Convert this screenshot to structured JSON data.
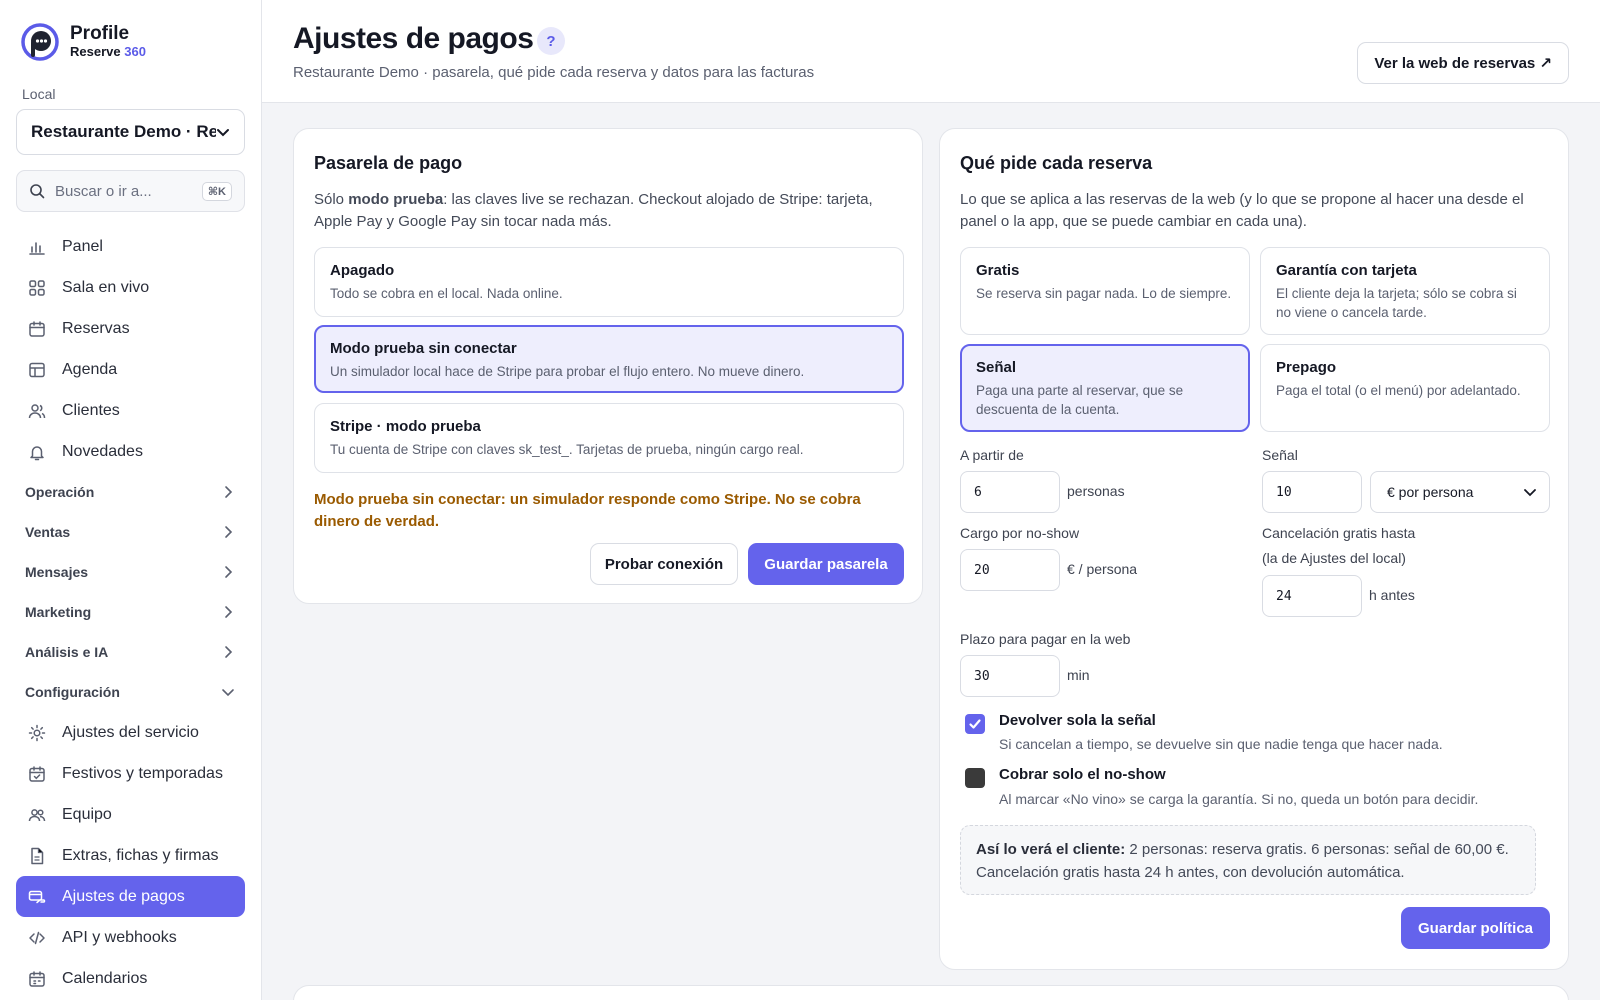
{
  "brand": {
    "name": "Profile",
    "sub_main": "Reserve",
    "sub_accent": "360"
  },
  "sidebar": {
    "local_label": "Local",
    "local_value": "Restaurante Demo · Res",
    "search_placeholder": "Buscar o ir a...",
    "search_shortcut": "⌘K",
    "items_top": [
      {
        "label": "Panel",
        "icon": "bar-chart-icon"
      },
      {
        "label": "Sala en vivo",
        "icon": "grid-icon"
      },
      {
        "label": "Reservas",
        "icon": "calendar-icon"
      },
      {
        "label": "Agenda",
        "icon": "table-icon"
      },
      {
        "label": "Clientes",
        "icon": "users-icon"
      },
      {
        "label": "Novedades",
        "icon": "bell-icon"
      }
    ],
    "groups": [
      {
        "label": "Operación"
      },
      {
        "label": "Ventas"
      },
      {
        "label": "Mensajes"
      },
      {
        "label": "Marketing"
      },
      {
        "label": "Análisis e IA"
      },
      {
        "label": "Configuración"
      }
    ],
    "config_items": [
      {
        "label": "Ajustes del servicio",
        "icon": "sun-icon"
      },
      {
        "label": "Festivos y temporadas",
        "icon": "calendar-check-icon"
      },
      {
        "label": "Equipo",
        "icon": "team-icon"
      },
      {
        "label": "Extras, fichas y firmas",
        "icon": "document-icon"
      },
      {
        "label": "Ajustes de pagos",
        "icon": "payment-icon",
        "active": true
      },
      {
        "label": "API y webhooks",
        "icon": "code-icon"
      },
      {
        "label": "Calendarios",
        "icon": "calendar-icon"
      }
    ]
  },
  "header": {
    "title": "Ajustes de pagos",
    "help": "?",
    "subtitle": "Restaurante Demo · pasarela, qué pide cada reserva y datos para las facturas",
    "web_button": "Ver la web de reservas ↗"
  },
  "gateway": {
    "title": "Pasarela de pago",
    "desc_pre": "Sólo ",
    "desc_bold": "modo prueba",
    "desc_post": ": las claves live se rechazan. Checkout alojado de Stripe: tarjeta, Apple Pay y Google Pay sin tocar nada más.",
    "options": [
      {
        "title": "Apagado",
        "desc": "Todo se cobra en el local. Nada online.",
        "selected": false
      },
      {
        "title": "Modo prueba sin conectar",
        "desc": "Un simulador local hace de Stripe para probar el flujo entero. No mueve dinero.",
        "selected": true
      },
      {
        "title": "Stripe · modo prueba",
        "desc": "Tu cuenta de Stripe con claves sk_test_. Tarjetas de prueba, ningún cargo real.",
        "selected": false
      }
    ],
    "warning": "Modo prueba sin conectar: un simulador responde como Stripe. No se cobra dinero de verdad.",
    "test_button": "Probar conexión",
    "save_button": "Guardar pasarela"
  },
  "policy": {
    "title": "Qué pide cada reserva",
    "desc": "Lo que se aplica a las reservas de la web (y lo que se propone al hacer una desde el panel o la app, que se puede cambiar en cada una).",
    "options": [
      {
        "title": "Gratis",
        "desc": "Se reserva sin pagar nada. Lo de siempre.",
        "selected": false
      },
      {
        "title": "Garantía con tarjeta",
        "desc": "El cliente deja la tarjeta; sólo se cobra si no viene o cancela tarde.",
        "selected": false
      },
      {
        "title": "Señal",
        "desc": "Paga una parte al reservar, que se descuenta de la cuenta.",
        "selected": true
      },
      {
        "title": "Prepago",
        "desc": "Paga el total (o el menú) por adelantado.",
        "selected": false
      }
    ],
    "from_label": "A partir de",
    "from_value": "6",
    "from_unit": "personas",
    "deposit_label": "Señal",
    "deposit_value": "10",
    "deposit_mode": "€ por persona",
    "noshow_label": "Cargo por no-show",
    "noshow_value": "20",
    "noshow_unit": "€ / persona",
    "cancel_label": "Cancelación gratis hasta",
    "cancel_sub": "(la de Ajustes del local)",
    "cancel_value": "24",
    "cancel_unit": "h antes",
    "term_label": "Plazo para pagar en la web",
    "term_value": "30",
    "term_unit": "min",
    "refund_title": "Devolver sola la señal",
    "refund_desc": "Si cancelan a tiempo, se devuelve sin que nadie tenga que hacer nada.",
    "refund_checked": true,
    "charge_title": "Cobrar solo el no-show",
    "charge_desc": "Al marcar «No vino» se carga la garantía. Si no, queda un botón para decidir.",
    "charge_checked": false,
    "preview_bold": "Así lo verá el cliente:",
    "preview_text": " 2 personas: reserva gratis. 6 personas: señal de 60,00 €. Cancelación gratis hasta 24 h antes, con devolución automática.",
    "save_button": "Guardar política"
  },
  "colors": {
    "accent": "#6463ec",
    "warning": "#9a5a00",
    "selected_bg": "#eeeefd"
  }
}
